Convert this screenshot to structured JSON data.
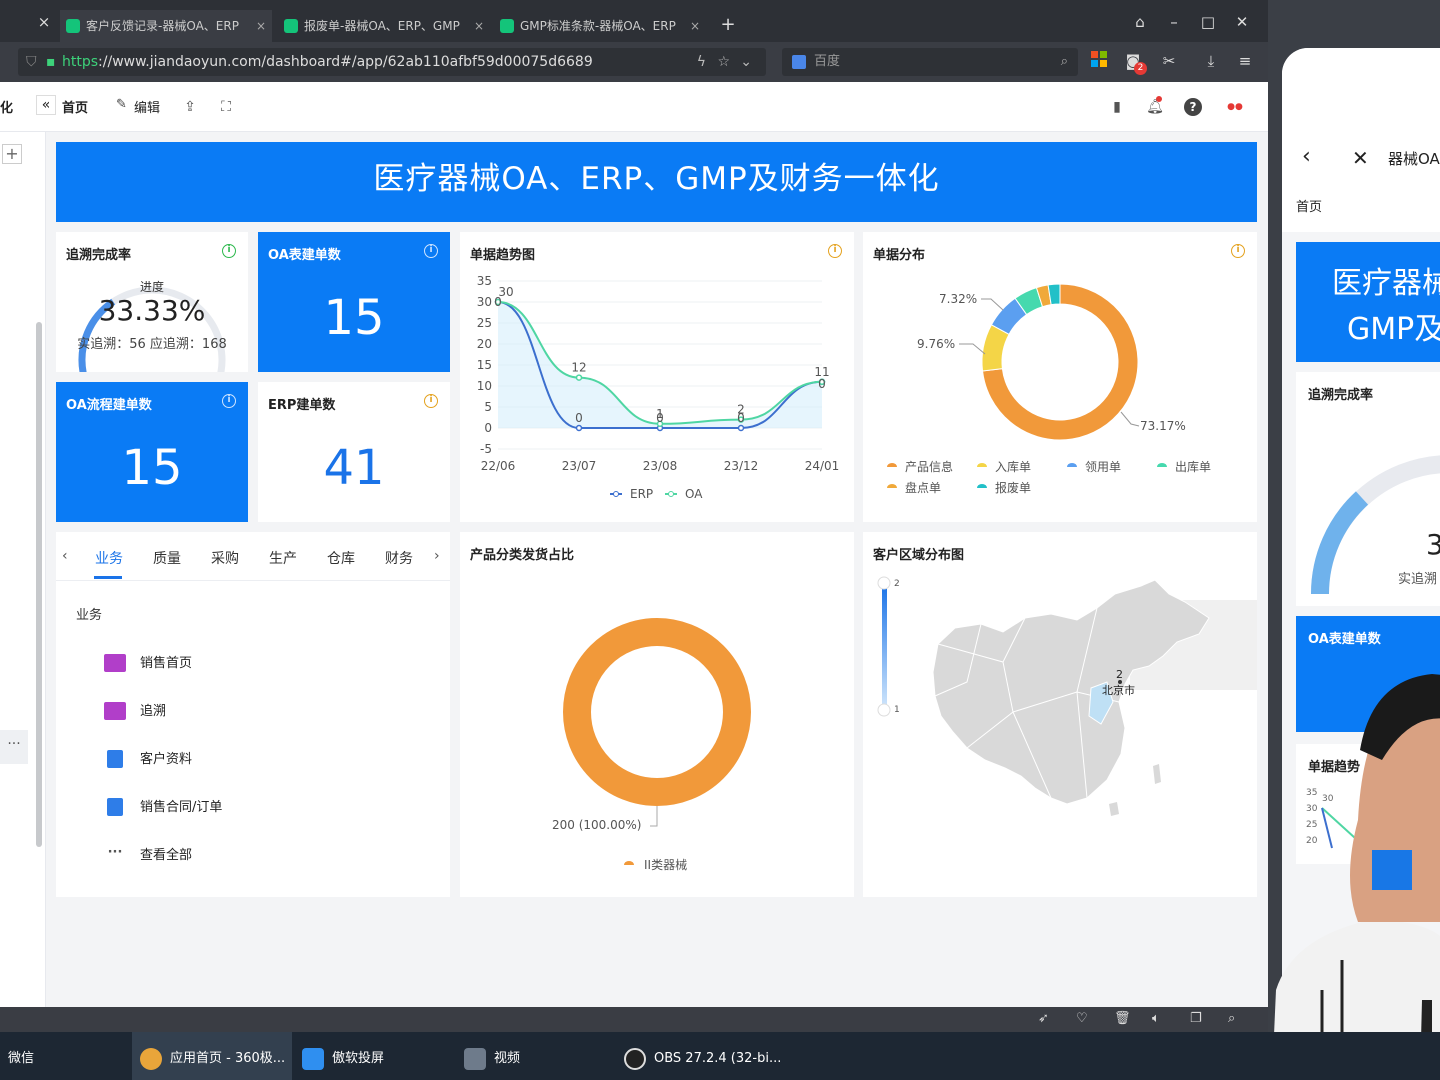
{
  "browser": {
    "tabs": [
      {
        "label": "客户反馈记录-器械OA、ERP"
      },
      {
        "label": "报废单-器械OA、ERP、GMP"
      },
      {
        "label": "GMP标准条款-器械OA、ERP"
      }
    ],
    "url_scheme": "https",
    "url_rest": "://www.jiandaoyun.com/dashboard#/app/62ab110afbf59d00075d6689",
    "search_placeholder": "百度",
    "badge_count": "2"
  },
  "app": {
    "sidebar_partial_label": "化",
    "nav_home": "首页",
    "nav_edit": "编辑",
    "banner_title": "医疗器械OA、ERP、GMP及财务一体化"
  },
  "cards": {
    "trace": {
      "title": "追溯完成率",
      "gauge_label": "进度",
      "percent": "33.33%",
      "detail": "实追溯：56 应追溯：168",
      "progress": 0.3333
    },
    "oa_form": {
      "title": "OA表建单数",
      "value": "15"
    },
    "oa_flow": {
      "title": "OA流程建单数",
      "value": "15"
    },
    "erp": {
      "title": "ERP建单数",
      "value": "41"
    },
    "trend": {
      "title": "单据趋势图"
    },
    "distribution": {
      "title": "单据分布"
    },
    "product": {
      "title": "产品分类发货占比"
    },
    "region": {
      "title": "客户区域分布图"
    }
  },
  "business": {
    "tabs": [
      "业务",
      "质量",
      "采购",
      "生产",
      "仓库",
      "财务"
    ],
    "section_label": "业务",
    "items": [
      "销售首页",
      "追溯",
      "客户资料",
      "销售合同/订单",
      "查看全部"
    ]
  },
  "chart_data": [
    {
      "type": "line",
      "title": "单据趋势图",
      "categories": [
        "22/06",
        "23/07",
        "23/08",
        "23/12",
        "24/01"
      ],
      "series": [
        {
          "name": "ERP",
          "values": [
            30,
            0,
            0,
            0,
            11
          ],
          "color": "#3c6fce"
        },
        {
          "name": "OA",
          "values": [
            30,
            12,
            1,
            2,
            11
          ],
          "color": "#4fd6a3"
        }
      ],
      "point_labels_top": [
        "30",
        "12",
        "1",
        "2",
        "11"
      ],
      "point_labels_bottom": [
        "0",
        "0",
        "0",
        "0",
        "0"
      ],
      "yticks": [
        "35",
        "30",
        "25",
        "20",
        "15",
        "10",
        "5",
        "0",
        "-5"
      ],
      "ylim": [
        -5,
        35
      ],
      "legend": "bottom"
    },
    {
      "type": "pie",
      "title": "单据分布",
      "labels": [
        "产品信息",
        "入库单",
        "领用单",
        "出库单",
        "盘点单",
        "报废单"
      ],
      "values": [
        73.17,
        9.76,
        7.32,
        4.88,
        2.44,
        2.44
      ],
      "colors": [
        "#f1993a",
        "#f4d547",
        "#5b9ff0",
        "#46d9ae",
        "#f0a93a",
        "#22c0c8"
      ],
      "shown_labels": [
        "73.17%",
        "9.76%",
        "7.32%"
      ],
      "legend": "bottom"
    },
    {
      "type": "pie",
      "title": "产品分类发货占比",
      "labels": [
        "II类器械"
      ],
      "values": [
        200
      ],
      "colors": [
        "#f1993a"
      ],
      "slice_label": "200 (100.00%)",
      "legend": "bottom"
    },
    {
      "type": "heatmap",
      "title": "客户区域分布图",
      "scale_max": "2",
      "scale_min": "1",
      "region_label": "北京市",
      "region_value": "2"
    }
  ],
  "phone": {
    "title_partial": "器械OA",
    "home": "首页",
    "banner_line1": "医疗器械",
    "banner_line2": "GMP及",
    "trace_title": "追溯完成率",
    "trace_detail": "实追溯",
    "trace_partial": "3",
    "oa_title": "OA表建单数",
    "trend_title": "单据趋势",
    "trend_ticks": [
      "35",
      "30",
      "25",
      "20"
    ],
    "trend_point": "30"
  },
  "taskbar": [
    {
      "label": "微信"
    },
    {
      "label": "应用首页 - 360极..."
    },
    {
      "label": "傲软投屏"
    },
    {
      "label": "视频"
    },
    {
      "label": "OBS 27.2.4 (32-bi..."
    }
  ]
}
